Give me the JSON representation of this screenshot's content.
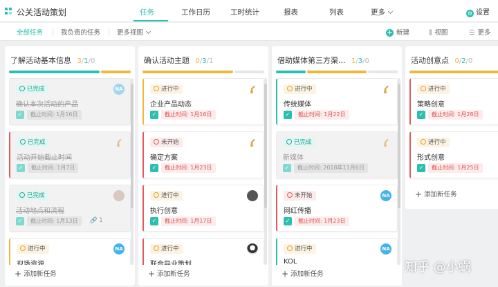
{
  "app": {
    "title": "公关活动策划",
    "settings_label": "设置"
  },
  "nav": {
    "tabs": [
      "任务",
      "工作日历",
      "工时统计",
      "报表",
      "列表",
      "更多"
    ]
  },
  "subnav": {
    "tabs": [
      "全部任务",
      "我负责的任务",
      "更多视图"
    ],
    "new_label": "新建",
    "view_label": "视图",
    "more_label": "更多"
  },
  "colors": {
    "accent": "#2bbfb0",
    "done": "#2bbfb0",
    "in_progress": "#f0b73a",
    "todo": "#e25b5b"
  },
  "columns": [
    {
      "title": "了解活动基本信息",
      "count_done": "3",
      "count_progress": "1",
      "count_todo": "0",
      "sep": "/",
      "cards": [
        {
          "status": "已完成",
          "title": "确认本次活动的产品",
          "due": "截止时间: 1月16日"
        },
        {
          "status": "已完成",
          "title": "活动开始截止时间",
          "due": "截止时间: 1月7日"
        },
        {
          "status": "已完成",
          "title": "活动地点和流程",
          "due": "截止时间: 1月13日",
          "attach": "1"
        },
        {
          "status": "进行中",
          "title": "现场资源",
          "due": ""
        }
      ]
    },
    {
      "title": "确认活动主题",
      "count_done": "0",
      "count_progress": "3",
      "count_todo": "1",
      "sep": "/",
      "cards": [
        {
          "status": "进行中",
          "title": "企业产品动态",
          "due": "截止时间: 1月16日"
        },
        {
          "status": "未开始",
          "title": "确定方案",
          "due": "截止时间: 1月23日"
        },
        {
          "status": "进行中",
          "title": "执行创意",
          "due": "截止时间: 1月17日"
        },
        {
          "status": "进行中",
          "title": "联合异业策划",
          "due": ""
        }
      ]
    },
    {
      "title": "借助媒体第三方渠...",
      "count_done": "1",
      "count_progress": "3",
      "count_todo": "0",
      "sep": "/",
      "cards": [
        {
          "status": "进行中",
          "title": "传统媒体",
          "due": "截止时间: 1月22日"
        },
        {
          "status": "已完成",
          "title": "新媒体",
          "due": "截止时间: 2018年11月6日"
        },
        {
          "status": "未开始",
          "title": "网红传播",
          "due": "截止时间: 1月23日"
        },
        {
          "status": "进行中",
          "title": "KOL",
          "due": ""
        }
      ]
    },
    {
      "title": "活动创意点",
      "count_done": "0",
      "count_progress": "2",
      "count_todo": "0",
      "sep": "/",
      "cards": [
        {
          "status": "进行中",
          "title": "策略创意",
          "due": "截止时间: 1月28日"
        },
        {
          "status": "进行中",
          "title": "形式创意",
          "due": "截止时间: 1月25日"
        }
      ]
    }
  ],
  "add_task_label": "添加新任务",
  "avatars": {
    "na": "NA"
  },
  "watermark": "知乎 @小蜗"
}
